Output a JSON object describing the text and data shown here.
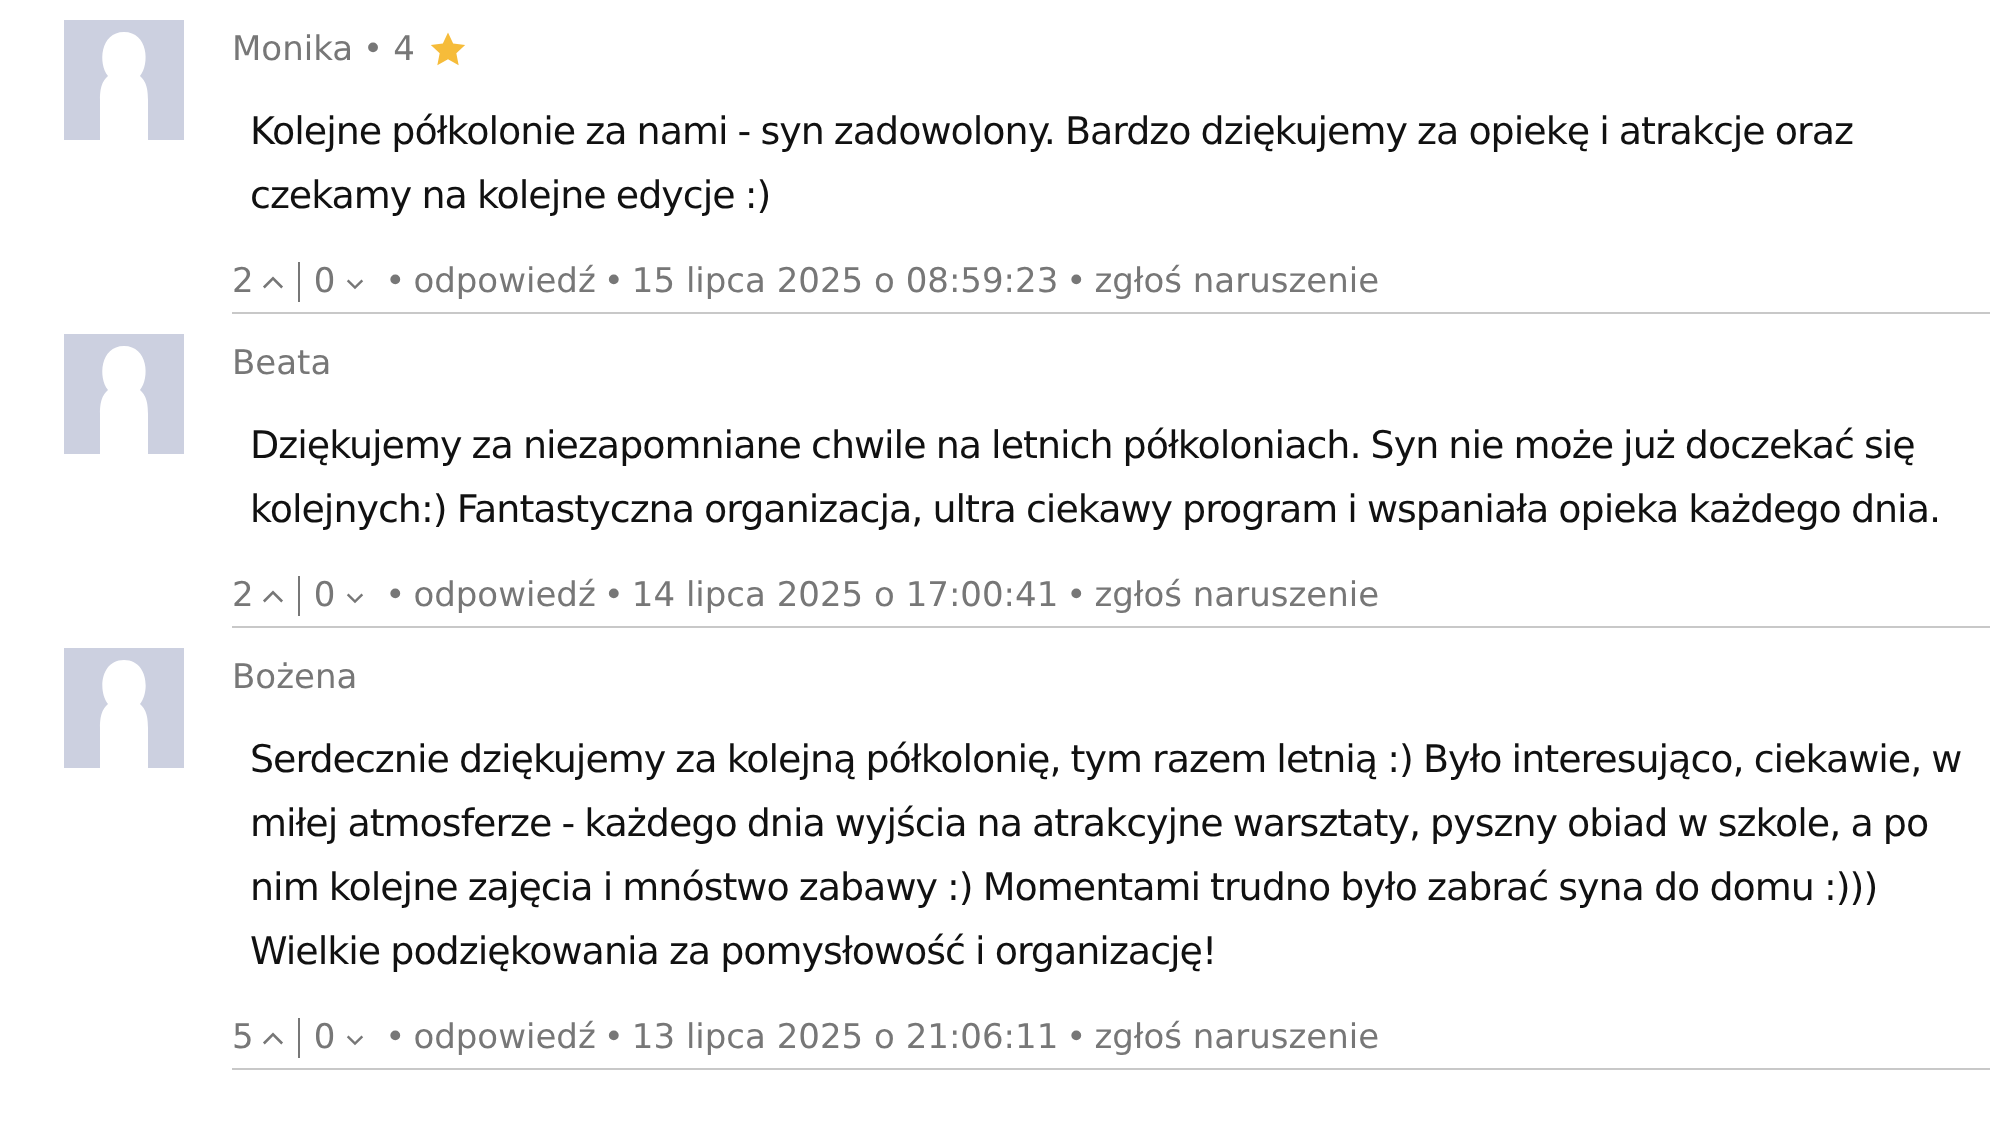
{
  "separator": "•",
  "comments": [
    {
      "author": "Monika",
      "rating": "4",
      "body": "Kolejne półkolonie za nami - syn zadowolony. Bardzo dziękujemy za opiekę i atrakcje oraz czekamy na kolejne edycje :)",
      "upvotes": "2",
      "downvotes": "0",
      "reply": "odpowiedź",
      "date": "15 lipca 2025 o 08:59:23",
      "report": "zgłoś naruszenie"
    },
    {
      "author": "Beata",
      "body": "Dziękujemy za niezapomniane chwile na letnich półkoloniach. Syn nie może już doczekać się kolejnych:) Fantastyczna organizacja, ultra ciekawy program i wspaniała opieka każdego dnia.",
      "upvotes": "2",
      "downvotes": "0",
      "reply": "odpowiedź",
      "date": "14 lipca 2025 o 17:00:41",
      "report": "zgłoś naruszenie"
    },
    {
      "author": "Bożena",
      "body": "Serdecznie dziękujemy za kolejną półkolonię, tym razem letnią :) Było interesująco, ciekawie, w miłej atmosferze - każdego dnia wyjścia na atrakcyjne warsztaty, pyszny obiad w szkole, a po nim kolejne zajęcia i mnóstwo zabawy :) Momentami trudno było zabrać syna do domu :))) Wielkie podziękowania za pomysłowość i organizację!",
      "upvotes": "5",
      "downvotes": "0",
      "reply": "odpowiedź",
      "date": "13 lipca 2025 o 21:06:11",
      "report": "zgłoś naruszenie"
    }
  ]
}
